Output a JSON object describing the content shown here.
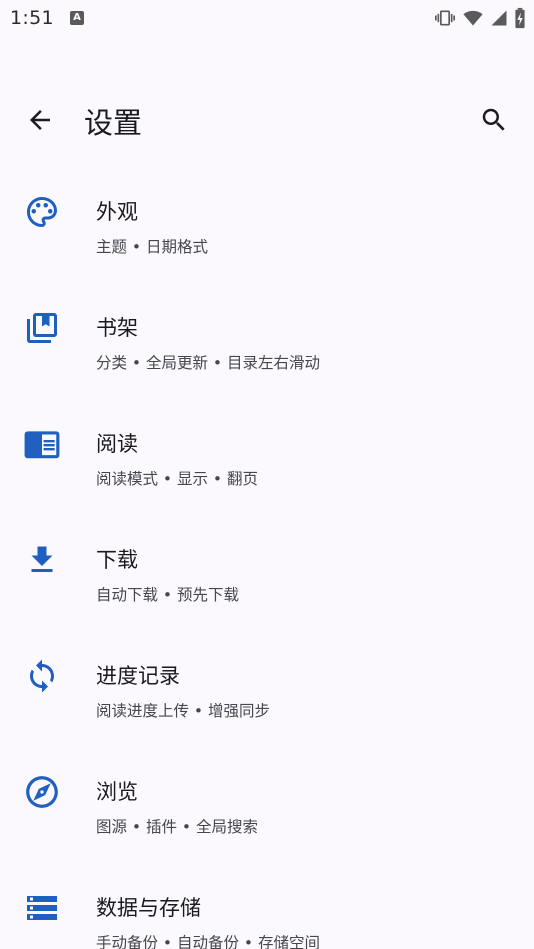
{
  "status_bar": {
    "time": "1:51",
    "notification_icon": "a-icon",
    "indicators": [
      "vibrate-icon",
      "wifi-icon",
      "signal-icon",
      "battery-charging-icon"
    ]
  },
  "header": {
    "back_icon": "arrow-back-icon",
    "title": "设置",
    "search_icon": "search-icon"
  },
  "colors": {
    "accent": "#1f5fbf",
    "background": "#fbf9fd",
    "title_text": "#1b1b1f",
    "subtitle_text": "#46464f"
  },
  "settings": {
    "items": [
      {
        "title": "外观",
        "subtitle": "主题 • 日期格式",
        "icon": "palette-icon"
      },
      {
        "title": "书架",
        "subtitle": "分类 • 全局更新 • 目录左右滑动",
        "icon": "library-icon"
      },
      {
        "title": "阅读",
        "subtitle": "阅读模式 • 显示 • 翻页",
        "icon": "chrome-reader-icon"
      },
      {
        "title": "下载",
        "subtitle": "自动下载 • 预先下载",
        "icon": "download-icon"
      },
      {
        "title": "进度记录",
        "subtitle": "阅读进度上传 • 增强同步",
        "icon": "sync-icon"
      },
      {
        "title": "浏览",
        "subtitle": "图源 • 插件 • 全局搜索",
        "icon": "explore-icon"
      },
      {
        "title": "数据与存储",
        "subtitle": "手动备份 • 自动备份 • 存储空间",
        "icon": "storage-icon"
      }
    ]
  }
}
